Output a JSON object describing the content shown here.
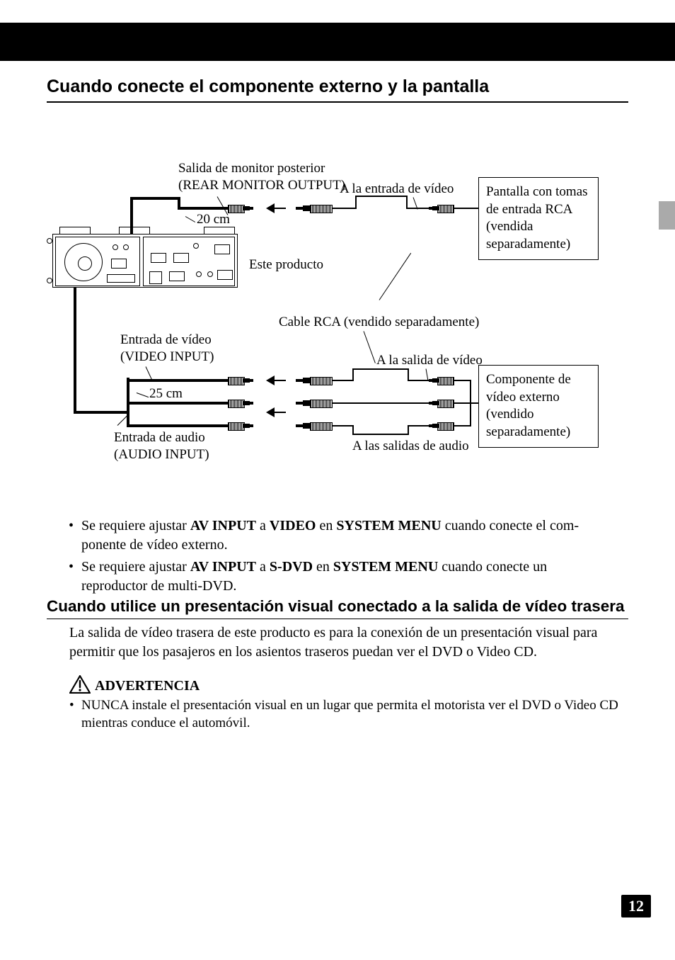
{
  "header": {
    "title": "Cuando conecte el componente externo y la pantalla"
  },
  "diagram": {
    "rear_monitor_output": "Salida de monitor posterior\n(REAR MONITOR OUTPUT)",
    "len_20cm": "20 cm",
    "to_video_input": "A la entrada de vídeo",
    "display_box": "Pantalla con tomas de entrada RCA (vendida separadamente)",
    "this_product": "Este producto",
    "rca_cable": "Cable RCA (vendido separadamente)",
    "video_input": "Entrada de vídeo\n(VIDEO INPUT)",
    "to_video_output": "A la salida de vídeo",
    "len_25cm": "25 cm",
    "component_box": "Componente de vídeo externo (vendido separadamente)",
    "audio_input": "Entrada de audio\n(AUDIO INPUT)",
    "to_audio_outputs": "A las salidas de audio"
  },
  "bullets": {
    "b1_pre": "Se requiere ajustar ",
    "b1_b1": "AV INPUT",
    "b1_mid1": " a ",
    "b1_b2": "VIDEO",
    "b1_mid2": " en ",
    "b1_b3": "SYSTEM MENU",
    "b1_post": " cuando conecte el com-\nponente de vídeo externo.",
    "b2_pre": "Se requiere ajustar ",
    "b2_b1": "AV INPUT",
    "b2_mid1": " a ",
    "b2_b2": "S-DVD",
    "b2_mid2": " en ",
    "b2_b3": "SYSTEM MENU",
    "b2_post": " cuando conecte un\nreproductor de multi-DVD."
  },
  "subsection": {
    "title": "Cuando utilice un presentación visual conectado a la salida de vídeo trasera",
    "para": "La salida de vídeo trasera de este producto es para la conexión de un presentación visual para permitir que los pasajeros en los asientos traseros puedan ver el DVD o Video CD."
  },
  "warning": {
    "label": "ADVERTENCIA",
    "text": "NUNCA instale el presentación visual en un lugar que permita el motorista ver el DVD o Video CD mientras conduce el automóvil."
  },
  "page": "12"
}
